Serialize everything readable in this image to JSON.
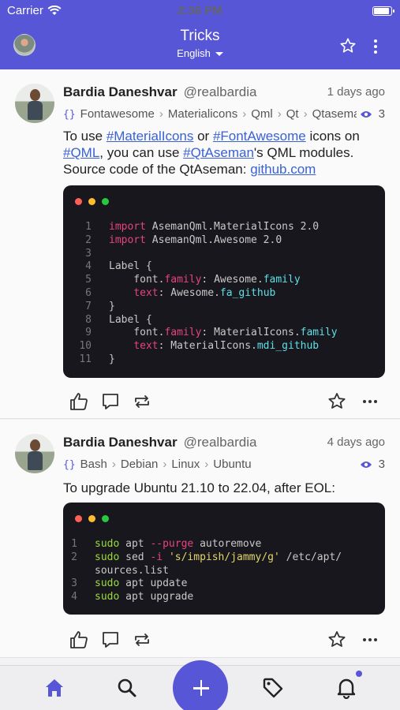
{
  "status": {
    "carrier": "Carrier",
    "time": "2:36 PM"
  },
  "header": {
    "title": "Tricks",
    "language": "English"
  },
  "posts": [
    {
      "author": "Bardia Daneshvar",
      "handle": "@realbardia",
      "time": "1 days ago",
      "tags": [
        "Fontawesome",
        "Materialicons",
        "Qml",
        "Qt",
        "Qtaseman"
      ],
      "views": "3",
      "text": {
        "p1": "To use ",
        "l1": "#MaterialIcons",
        "p2": " or ",
        "l2": "#FontAwesome",
        "p3": " icons on ",
        "l3": "#QML",
        "p4": ", you can use ",
        "l4": "#QtAseman",
        "p5": "'s QML modules. Source code of the QtAseman: ",
        "l5": "github.com"
      },
      "code": [
        {
          "n": "1",
          "parts": [
            {
              "c": "kw",
              "t": "import"
            },
            {
              "c": "",
              "t": " AsemanQml.MaterialIcons 2.0"
            }
          ]
        },
        {
          "n": "2",
          "parts": [
            {
              "c": "kw",
              "t": "import"
            },
            {
              "c": "",
              "t": " AsemanQml.Awesome 2.0"
            }
          ]
        },
        {
          "n": "3",
          "parts": []
        },
        {
          "n": "4",
          "parts": [
            {
              "c": "",
              "t": "Label {"
            }
          ]
        },
        {
          "n": "5",
          "parts": [
            {
              "c": "",
              "t": "    font."
            },
            {
              "c": "prop",
              "t": "family"
            },
            {
              "c": "",
              "t": ": Awesome."
            },
            {
              "c": "cyan",
              "t": "family"
            }
          ]
        },
        {
          "n": "6",
          "parts": [
            {
              "c": "",
              "t": "    "
            },
            {
              "c": "prop",
              "t": "text"
            },
            {
              "c": "",
              "t": ": Awesome."
            },
            {
              "c": "cyan",
              "t": "fa_github"
            }
          ]
        },
        {
          "n": "7",
          "parts": [
            {
              "c": "",
              "t": "}"
            }
          ]
        },
        {
          "n": "8",
          "parts": [
            {
              "c": "",
              "t": "Label {"
            }
          ]
        },
        {
          "n": "9",
          "parts": [
            {
              "c": "",
              "t": "    font."
            },
            {
              "c": "prop",
              "t": "family"
            },
            {
              "c": "",
              "t": ": MaterialIcons."
            },
            {
              "c": "cyan",
              "t": "family"
            }
          ]
        },
        {
          "n": "10",
          "parts": [
            {
              "c": "",
              "t": "    "
            },
            {
              "c": "prop",
              "t": "text"
            },
            {
              "c": "",
              "t": ": MaterialIcons."
            },
            {
              "c": "cyan",
              "t": "mdi_github"
            }
          ]
        },
        {
          "n": "11",
          "parts": [
            {
              "c": "",
              "t": "}"
            }
          ]
        }
      ]
    },
    {
      "author": "Bardia Daneshvar",
      "handle": "@realbardia",
      "time": "4 days ago",
      "tags": [
        "Bash",
        "Debian",
        "Linux",
        "Ubuntu"
      ],
      "views": "3",
      "text": {
        "plain": "To upgrade Ubuntu 21.10 to 22.04, after EOL:"
      },
      "code": [
        {
          "n": "1",
          "parts": [
            {
              "c": "green",
              "t": "sudo"
            },
            {
              "c": "",
              "t": " apt "
            },
            {
              "c": "op",
              "t": "--purge"
            },
            {
              "c": "",
              "t": " autoremove"
            }
          ]
        },
        {
          "n": "2",
          "parts": [
            {
              "c": "green",
              "t": "sudo"
            },
            {
              "c": "",
              "t": " sed "
            },
            {
              "c": "op",
              "t": "-i"
            },
            {
              "c": "",
              "t": " "
            },
            {
              "c": "str",
              "t": "'s/impish/jammy/g'"
            },
            {
              "c": "",
              "t": " /etc/apt/"
            }
          ]
        },
        {
          "n": "",
          "parts": [
            {
              "c": "",
              "t": "sources.list"
            }
          ]
        },
        {
          "n": "3",
          "parts": [
            {
              "c": "green",
              "t": "sudo"
            },
            {
              "c": "",
              "t": " apt update"
            }
          ]
        },
        {
          "n": "4",
          "parts": [
            {
              "c": "green",
              "t": "sudo"
            },
            {
              "c": "",
              "t": " apt upgrade"
            }
          ]
        }
      ]
    }
  ],
  "icons": {
    "nav": [
      "star-outline-icon",
      "more-vertical-icon"
    ],
    "actions": [
      "like-icon",
      "comment-icon",
      "retweet-icon",
      "bookmark-star-icon",
      "more-horizontal-icon"
    ],
    "tabs": [
      "home-icon",
      "search-icon",
      "add-icon",
      "tag-icon",
      "bell-icon"
    ]
  },
  "colors": {
    "accent": "#5656d6",
    "link": "#3a62d6",
    "code_bg": "#17171d"
  }
}
